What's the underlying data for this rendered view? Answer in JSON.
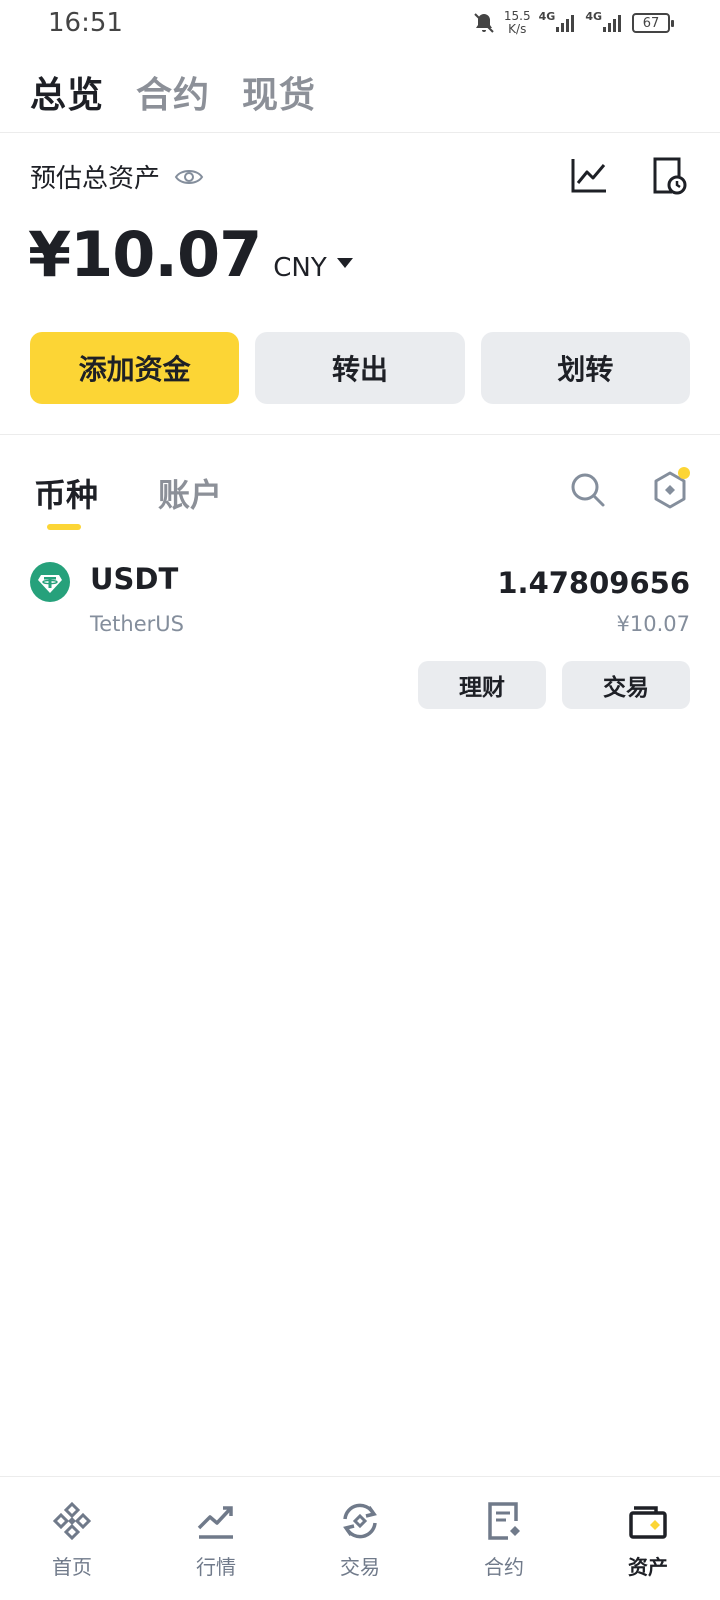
{
  "status": {
    "time": "16:51",
    "net_speed_value": "15.5",
    "net_speed_unit": "K/s",
    "battery": "67",
    "signal_1": "4G",
    "signal_2": "4G"
  },
  "top_tabs": [
    {
      "label": "总览",
      "active": true
    },
    {
      "label": "合约",
      "active": false
    },
    {
      "label": "现货",
      "active": false
    }
  ],
  "overview": {
    "estimated_label": "预估总资产",
    "amount": "¥10.07",
    "currency": "CNY"
  },
  "actions": {
    "add_funds": "添加资金",
    "withdraw": "转出",
    "transfer": "划转"
  },
  "sub_tabs": [
    {
      "label": "币种",
      "active": true
    },
    {
      "label": "账户",
      "active": false
    }
  ],
  "assets": [
    {
      "symbol": "USDT",
      "name": "TetherUS",
      "amount": "1.47809656",
      "value": "¥10.07",
      "earn_label": "理财",
      "trade_label": "交易"
    }
  ],
  "bottom_nav": [
    {
      "label": "首页",
      "icon": "binance-logo-icon"
    },
    {
      "label": "行情",
      "icon": "market-trend-icon"
    },
    {
      "label": "交易",
      "icon": "trade-swap-icon"
    },
    {
      "label": "合约",
      "icon": "futures-doc-icon"
    },
    {
      "label": "资产",
      "icon": "wallet-icon",
      "active": true
    }
  ],
  "colors": {
    "accent": "#fcd535",
    "tether": "#26a17b",
    "text_primary": "#1e2026",
    "text_secondary": "#848e9c",
    "button_bg": "#eaecef"
  }
}
